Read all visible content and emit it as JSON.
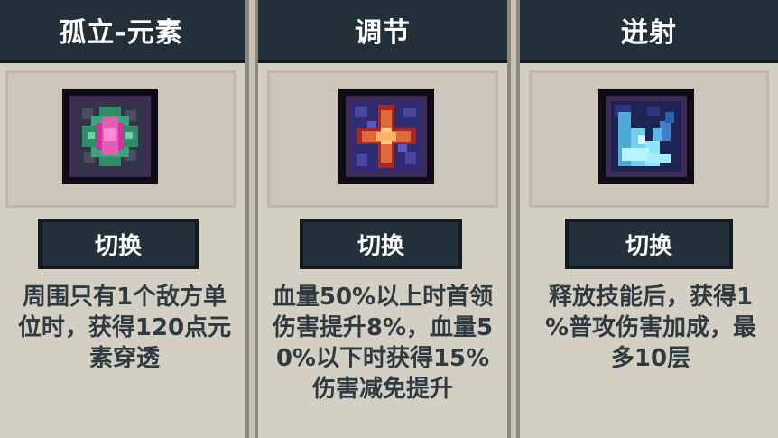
{
  "cards": [
    {
      "title": "孤立-元素",
      "icon": "element-orb-icon",
      "button_label": "切换",
      "description_lines": [
        "周围只有1个敌方单",
        "位时，获得120点元",
        "素穿透"
      ]
    },
    {
      "title": "调节",
      "icon": "sparkle-cross-icon",
      "button_label": "切换",
      "description_lines": [
        "血量50%以上时首领",
        "伤害提升8%，血量5",
        "0%以下时获得15%",
        "伤害减免提升"
      ]
    },
    {
      "title": "迸射",
      "icon": "ice-shard-icon",
      "button_label": "切换",
      "description_lines": [
        "释放技能后，获得1",
        "%普攻伤害加成，最",
        "多10层"
      ]
    }
  ],
  "colors": {
    "card_bg": "#d4cfc3",
    "header_bg": "#233039",
    "button_bg": "#233039",
    "text_dark": "#2f3a41",
    "icon_border": "#3e2b57"
  }
}
